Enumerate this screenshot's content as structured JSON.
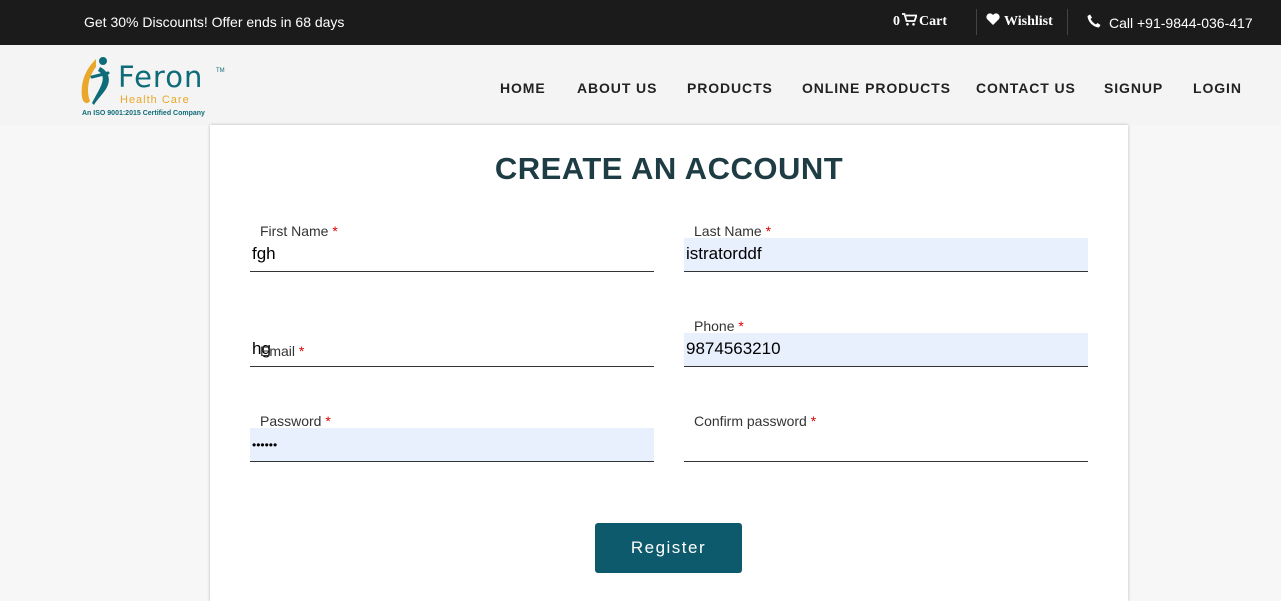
{
  "topbar": {
    "promo": "Get 30% Discounts! Offer ends in 68 days",
    "cart_count": "0",
    "cart_label": "Cart",
    "wishlist_label": "Wishlist",
    "call_label": "Call +91-9844-036-417"
  },
  "logo": {
    "brand": "Feron",
    "tm": "TM",
    "sub": "Health Care",
    "iso": "An ISO 9001:2015 Certified Company"
  },
  "nav": [
    "HOME",
    "ABOUT US",
    "PRODUCTS",
    "ONLINE PRODUCTS",
    "CONTACT US",
    "SIGNUP",
    "LOGIN"
  ],
  "form": {
    "title": "CREATE AN ACCOUNT",
    "required_mark": "*",
    "fields": {
      "first_name": {
        "label": "First Name",
        "value": "fgh"
      },
      "last_name": {
        "label": "Last Name",
        "value": "istratorddf"
      },
      "email": {
        "label": "Email",
        "value": "hg"
      },
      "phone": {
        "label": "Phone",
        "value": "9874563210"
      },
      "password": {
        "label": "Password",
        "value": "••••••"
      },
      "confirm_password": {
        "label": "Confirm password",
        "value": ""
      }
    },
    "register_label": "Register"
  },
  "colors": {
    "topbar_bg": "#1b1b1b",
    "header_bg": "#f4f4f4",
    "brand_teal": "#0e6b78",
    "brand_orange": "#e9a82b",
    "button_bg": "#0d5a6d",
    "autofill_bg": "#e8f0fe",
    "required": "#dd0000"
  }
}
